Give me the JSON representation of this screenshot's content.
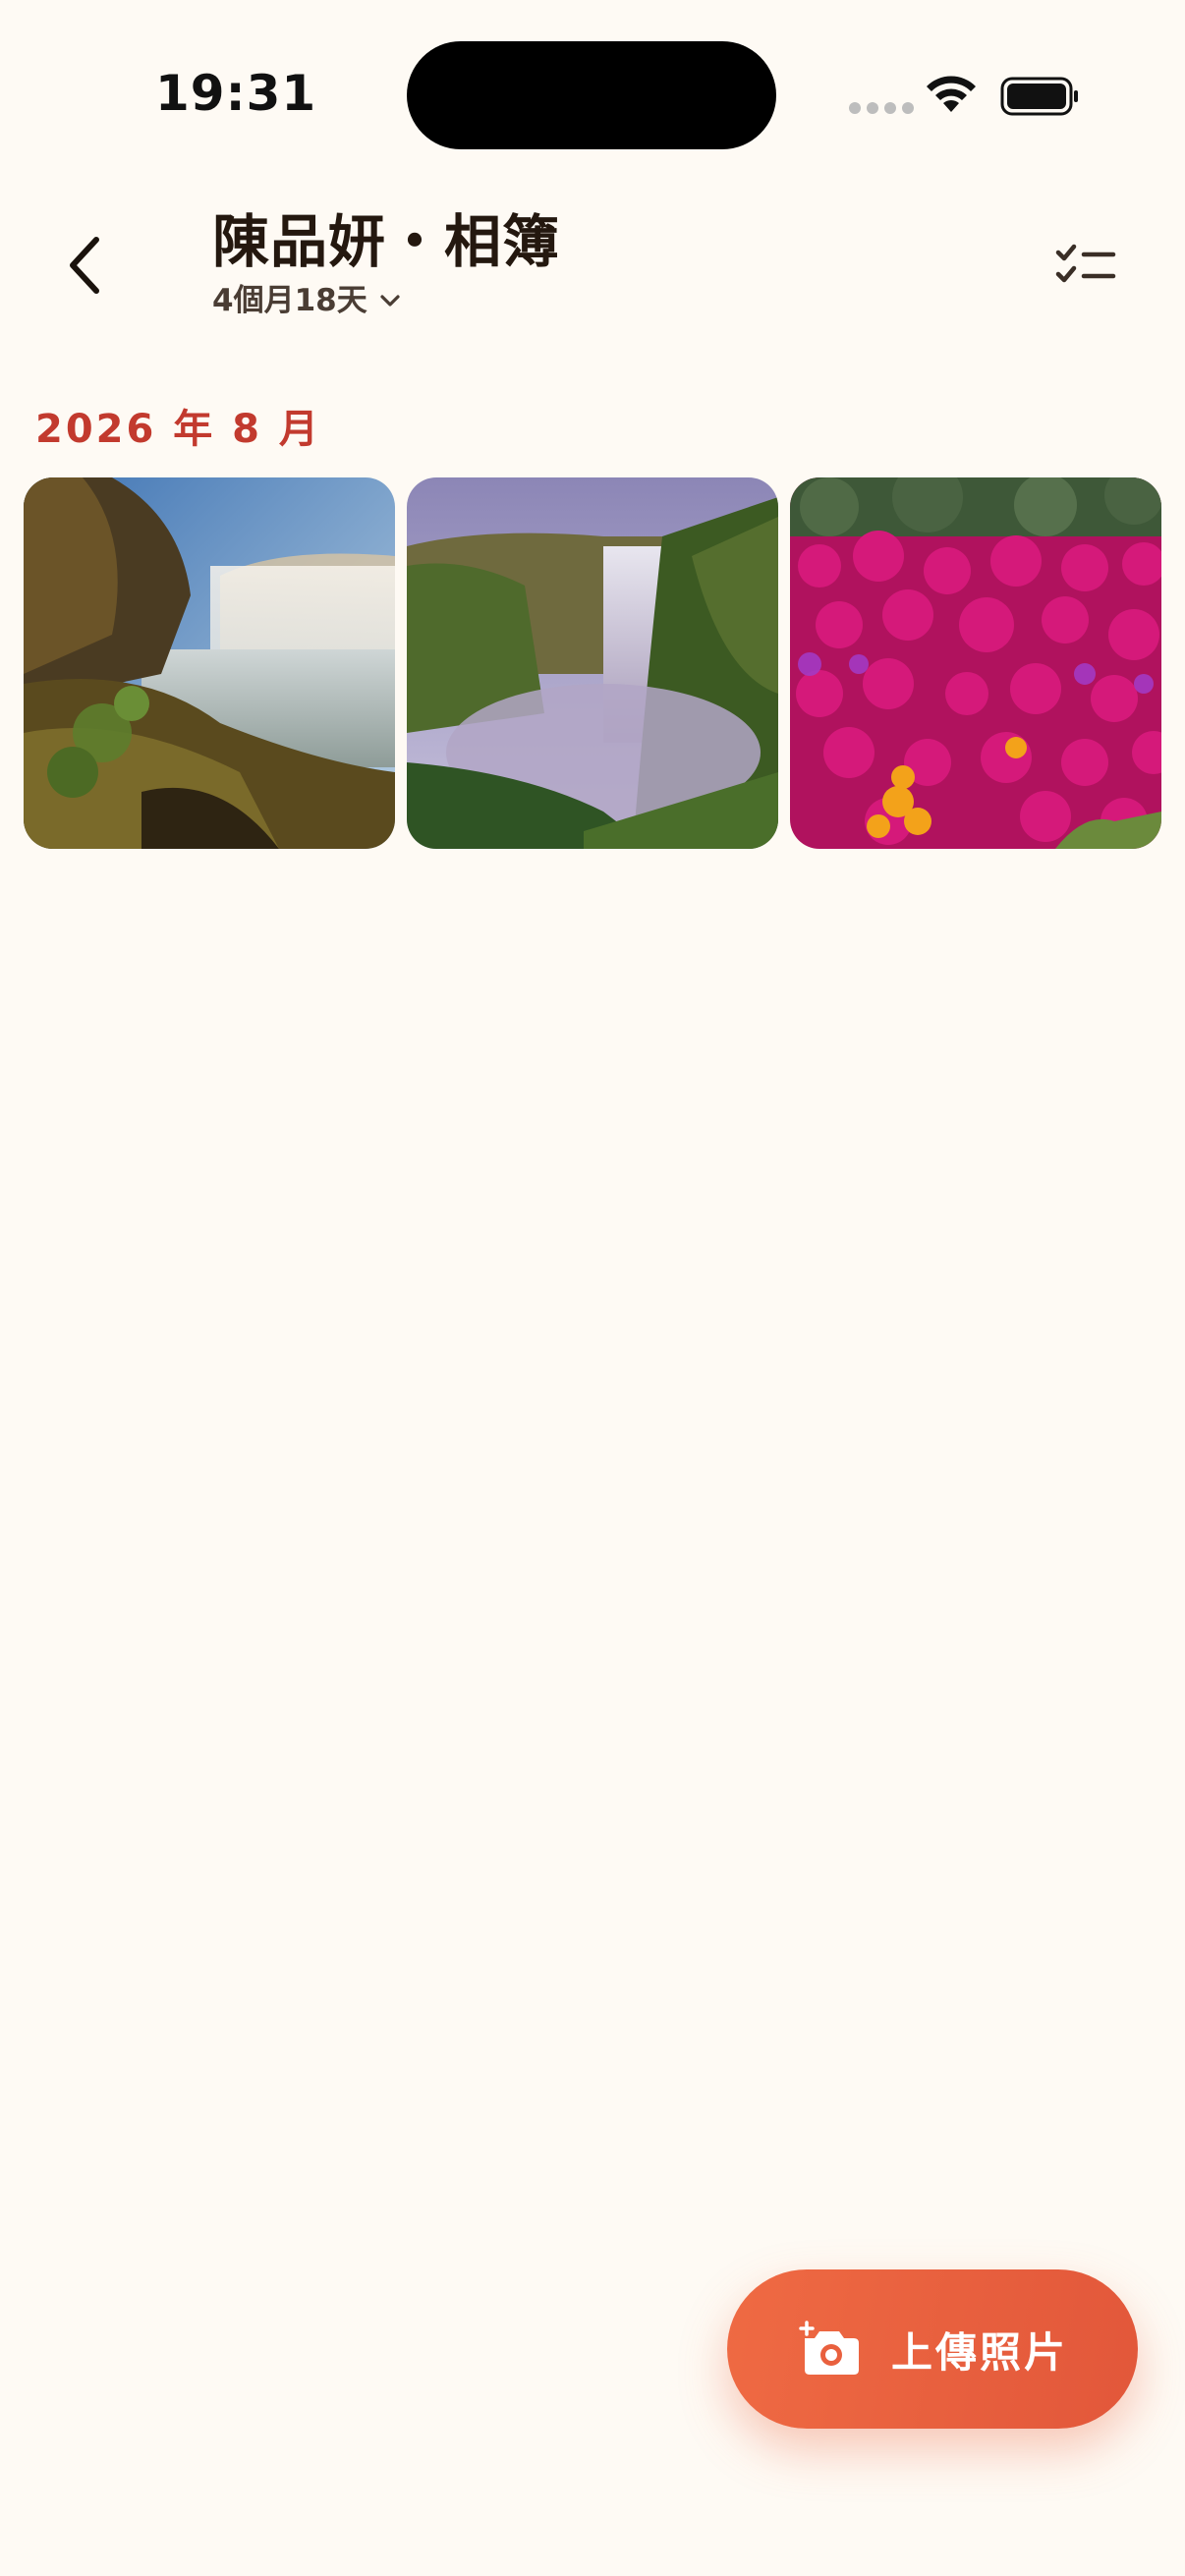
{
  "status_bar": {
    "time": "19:31"
  },
  "header": {
    "title": "陳品妍・相簿",
    "age_label": "4個月18天",
    "icons": {
      "back": "chevron-left-icon",
      "age_dropdown": "chevron-down-icon",
      "select": "checklist-icon"
    }
  },
  "sections": [
    {
      "heading": "2026 年 8 月",
      "photos": [
        {
          "subject": "waterfall-canyon"
        },
        {
          "subject": "waterfall-cliff"
        },
        {
          "subject": "magenta-flowers"
        }
      ]
    }
  ],
  "fab": {
    "label": "上傳照片",
    "icon": "camera-add-icon"
  },
  "colors": {
    "background": "#fefaf4",
    "accent": "#c23a2e",
    "fab": "#e9603e"
  }
}
